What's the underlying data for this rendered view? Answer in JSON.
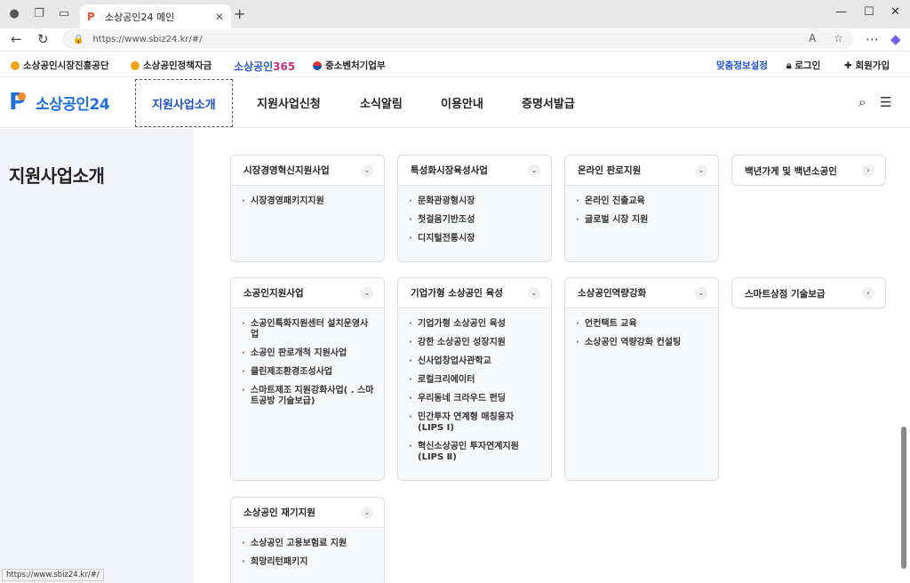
{
  "browser": {
    "tab_title": "소상공인24 메인",
    "tab_favicon": "P",
    "url": "https://www.sbiz24.kr/#/"
  },
  "util_bar": {
    "links": [
      "소상공인시장진흥공단",
      "소상공인정책자금",
      "중소벤처기업부"
    ],
    "brand365_text": "소상공인",
    "brand365_num": "365",
    "right_links": [
      "맞춤정보설정",
      "로그인",
      "회원가입"
    ]
  },
  "gnb": {
    "logo_text": "소상공인24",
    "menus": [
      "지원사업소개",
      "지원사업신청",
      "소식알림",
      "이용안내",
      "증명서발급"
    ]
  },
  "page": {
    "title": "지원사업소개"
  },
  "cards": [
    {
      "title": "시장경영혁신지원사업",
      "items": [
        "시장경영패키지지원"
      ]
    },
    {
      "title": "특성화시장육성사업",
      "items": [
        "문화관광형시장",
        "첫걸음기반조성",
        "디지털전통시장"
      ]
    },
    {
      "title": "온라인 판로지원",
      "items": [
        "온라인 진출교육",
        "글로벌 시장 지원"
      ]
    },
    {
      "title": "백년가게 및 백년소공인",
      "items": []
    },
    {
      "title": "소공인지원사업",
      "items": [
        "소공인특화지원센터 설치운영사업",
        "소공인 판로개척 지원사업",
        "클린제조환경조성사업",
        "스마트제조 지원강화사업( . 스마트공방 기술보급)"
      ]
    },
    {
      "title": "기업가형 소상공인 육성",
      "items": [
        "기업가형 소상공인 육성",
        "강한 소상공인 성장지원",
        "신사업창업사관학교",
        "로컬크리에이터",
        "우리동네 크라우드 펀딩",
        "민간투자 연계형 매칭융자 (LIPS Ⅰ)",
        "혁신소상공인 투자연계지원 (LIPS Ⅱ)"
      ]
    },
    {
      "title": "소상공인역량강화",
      "items": [
        "언컨택트 교육",
        "소상공인 역량강화 컨설팅"
      ]
    },
    {
      "title": "스마트상점 기술보급",
      "items": []
    },
    {
      "title": "소상공인 재기지원",
      "items": [
        "소상공인 고용보험료 지원",
        "희망리턴패키지"
      ]
    }
  ],
  "status_bar": "https://www.sbiz24.kr/#/",
  "colors": {
    "brand_blue": "#1e6fd6",
    "active_menu": "#1e50c8",
    "brand_pink": "#c4317c",
    "panel_bg": "#f1f3f6"
  }
}
